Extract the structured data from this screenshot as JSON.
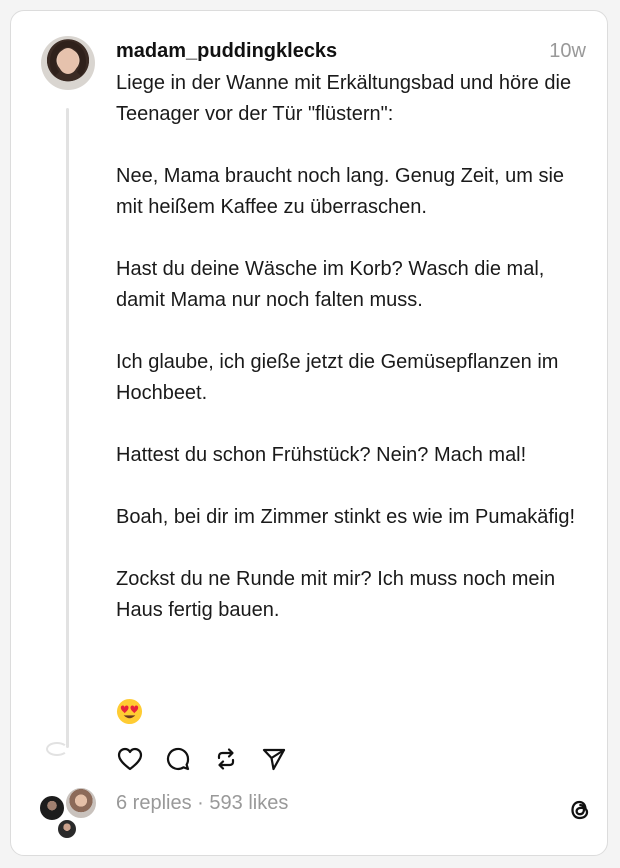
{
  "post": {
    "username": "madam_puddingklecks",
    "time": "10w",
    "paragraphs": [
      "Liege in der Wanne mit Erkältungsbad und höre die Teenager vor der Tür \"flüstern\":",
      "Nee, Mama braucht noch lang. Genug Zeit, um sie mit heißem Kaffee zu überraschen.",
      "Hast du deine Wäsche im Korb? Wasch die mal, damit Mama nur noch falten muss.",
      "Ich glaube, ich gieße jetzt die Gemüsepflanzen im Hochbeet.",
      "Hattest du schon Frühstück? Nein? Mach mal!",
      "Boah, bei dir im Zimmer stinkt es wie im Pumakäfig!",
      "Zockst du ne Runde mit mir? Ich muss noch mein Haus fertig bauen."
    ],
    "emoji": "😍"
  },
  "actions": {
    "like_icon": "heart-icon",
    "reply_icon": "comment-icon",
    "repost_icon": "repost-icon",
    "share_icon": "send-icon"
  },
  "stats": {
    "replies": "6 replies",
    "separator": " · ",
    "likes": "593 likes"
  },
  "colors": {
    "text": "#1a1a1a",
    "muted": "#999999",
    "line": "#e2e2e2"
  }
}
